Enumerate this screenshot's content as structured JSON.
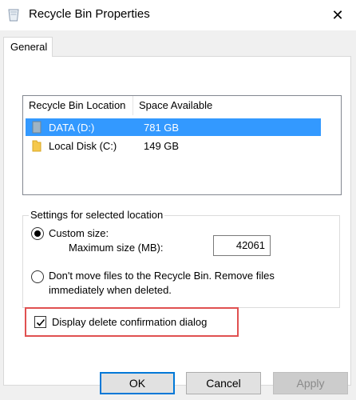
{
  "window": {
    "title": "Recycle Bin Properties",
    "close_glyph": "✕",
    "icon": "recycle-bin-icon"
  },
  "tabs": [
    {
      "label": "General",
      "active": true
    }
  ],
  "list": {
    "columns": [
      "Recycle Bin Location",
      "Space Available"
    ],
    "rows": [
      {
        "name": "DATA (D:)",
        "space": "781 GB",
        "selected": true,
        "icon": "drive-icon"
      },
      {
        "name": "Local Disk (C:)",
        "space": "149 GB",
        "selected": false,
        "icon": "folder-icon"
      }
    ]
  },
  "settings": {
    "legend": "Settings for selected location",
    "custom_size_label": "Custom size:",
    "max_size_label": "Maximum size (MB):",
    "max_size_value": "42061",
    "dont_move_line1": "Don't move files to the Recycle Bin. Remove files",
    "dont_move_line2": "immediately when deleted.",
    "custom_size_selected": true
  },
  "confirm": {
    "label": "Display delete confirmation dialog",
    "checked": true,
    "highlight_color": "#e05050"
  },
  "buttons": {
    "ok": "OK",
    "cancel": "Cancel",
    "apply": "Apply"
  },
  "colors": {
    "selection": "#3399ff",
    "accent": "#0078d7"
  }
}
